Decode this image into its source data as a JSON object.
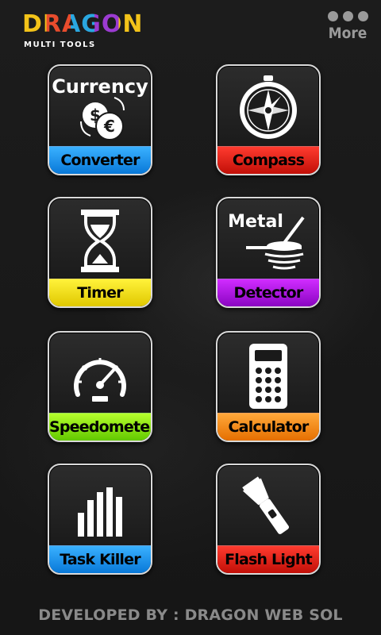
{
  "header": {
    "logo_word": "DRAGON",
    "logo_subtitle": "MULTI TOOLS",
    "more_label": "More",
    "more_icon": "dots-icon"
  },
  "tiles": [
    {
      "label": "Converter",
      "icon": "currency-icon",
      "icon_text": "Currency",
      "color": "#0a84e6"
    },
    {
      "label": "Compass",
      "icon": "compass-icon",
      "color": "#d01b10"
    },
    {
      "label": "Timer",
      "icon": "hourglass-icon",
      "color": "#f1dc10"
    },
    {
      "label": "Detector",
      "icon": "metal-detector-icon",
      "icon_text": "Metal",
      "color": "#a514e0"
    },
    {
      "label": "Speedometer",
      "icon": "speedometer-icon",
      "color": "#84e010"
    },
    {
      "label": "Calculator",
      "icon": "calculator-icon",
      "color": "#f08a14"
    },
    {
      "label": "Task Killer",
      "icon": "bars-icon",
      "color": "#0a84e6"
    },
    {
      "label": "Flash Light",
      "icon": "flashlight-icon",
      "color": "#d01b10"
    }
  ],
  "footer": {
    "text": "DEVELOPED BY : DRAGON WEB SOL"
  }
}
